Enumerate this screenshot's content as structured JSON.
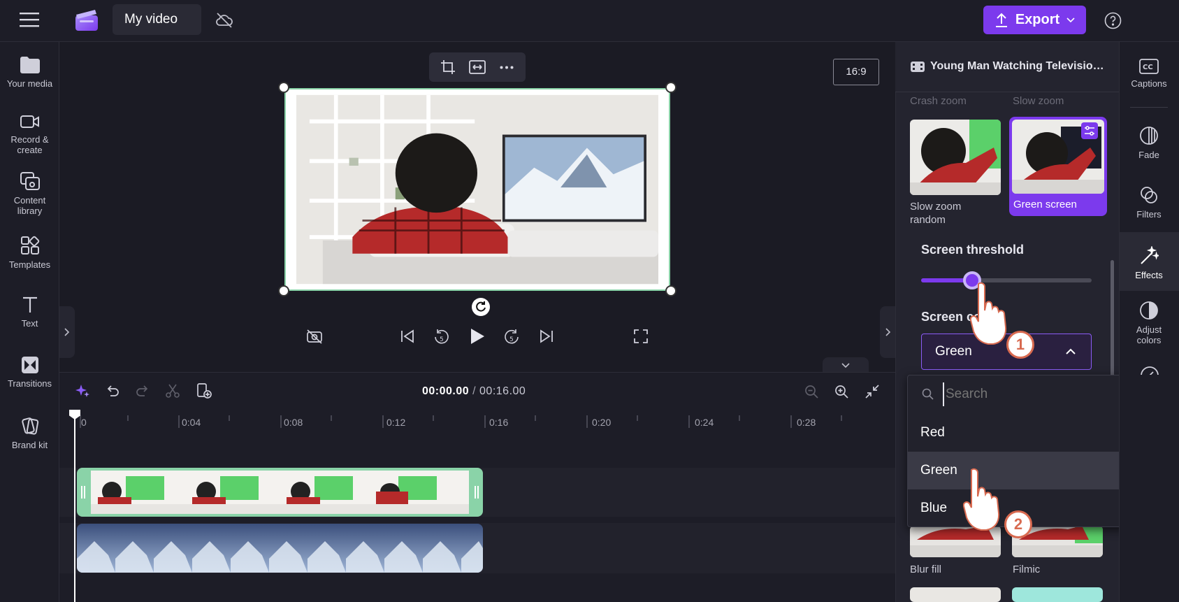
{
  "app": {
    "project_title": "My video",
    "export_label": "Export",
    "aspect_ratio": "16:9"
  },
  "left_nav": [
    {
      "label": "Your media",
      "icon": "folder-icon"
    },
    {
      "label": "Record & create",
      "icon": "camera-icon"
    },
    {
      "label": "Content library",
      "icon": "library-icon"
    },
    {
      "label": "Templates",
      "icon": "templates-icon"
    },
    {
      "label": "Text",
      "icon": "text-icon"
    },
    {
      "label": "Transitions",
      "icon": "transitions-icon"
    },
    {
      "label": "Brand kit",
      "icon": "brand-kit-icon"
    }
  ],
  "right_nav": [
    {
      "label": "Captions",
      "icon": "captions-icon"
    },
    {
      "label": "Fade",
      "icon": "fade-icon"
    },
    {
      "label": "Filters",
      "icon": "filters-icon"
    },
    {
      "label": "Effects",
      "icon": "effects-icon"
    },
    {
      "label": "Adjust colors",
      "icon": "adjust-colors-icon"
    }
  ],
  "panel": {
    "clip_title": "Young Man Watching Televisio…",
    "faded_labels": [
      "Crash zoom",
      "Slow zoom"
    ],
    "effects": [
      {
        "label": "Slow zoom random",
        "selected": false
      },
      {
        "label": "Green screen",
        "selected": true
      },
      {
        "label": "Blur fill",
        "selected": false
      },
      {
        "label": "Filmic",
        "selected": false
      }
    ],
    "threshold_label": "Screen threshold",
    "threshold_value": 0.3,
    "screen_color_label": "Screen co",
    "screen_color_value": "Green",
    "dropdown": {
      "search_placeholder": "Search",
      "options": [
        "Red",
        "Green",
        "Blue"
      ],
      "hovered": "Green"
    },
    "callouts": [
      "1",
      "2"
    ]
  },
  "playback": {
    "current_time": "00:00.00",
    "separator": "/",
    "total_time": "00:16.00"
  },
  "timeline": {
    "ticks": [
      "0",
      "0:04",
      "0:08",
      "0:12",
      "0:16",
      "0:20",
      "0:24",
      "0:28"
    ]
  },
  "colors": {
    "accent": "#7c3aed",
    "background": "#1d1d27",
    "panel": "#24242f",
    "green_clip": "#8ad3a8"
  }
}
